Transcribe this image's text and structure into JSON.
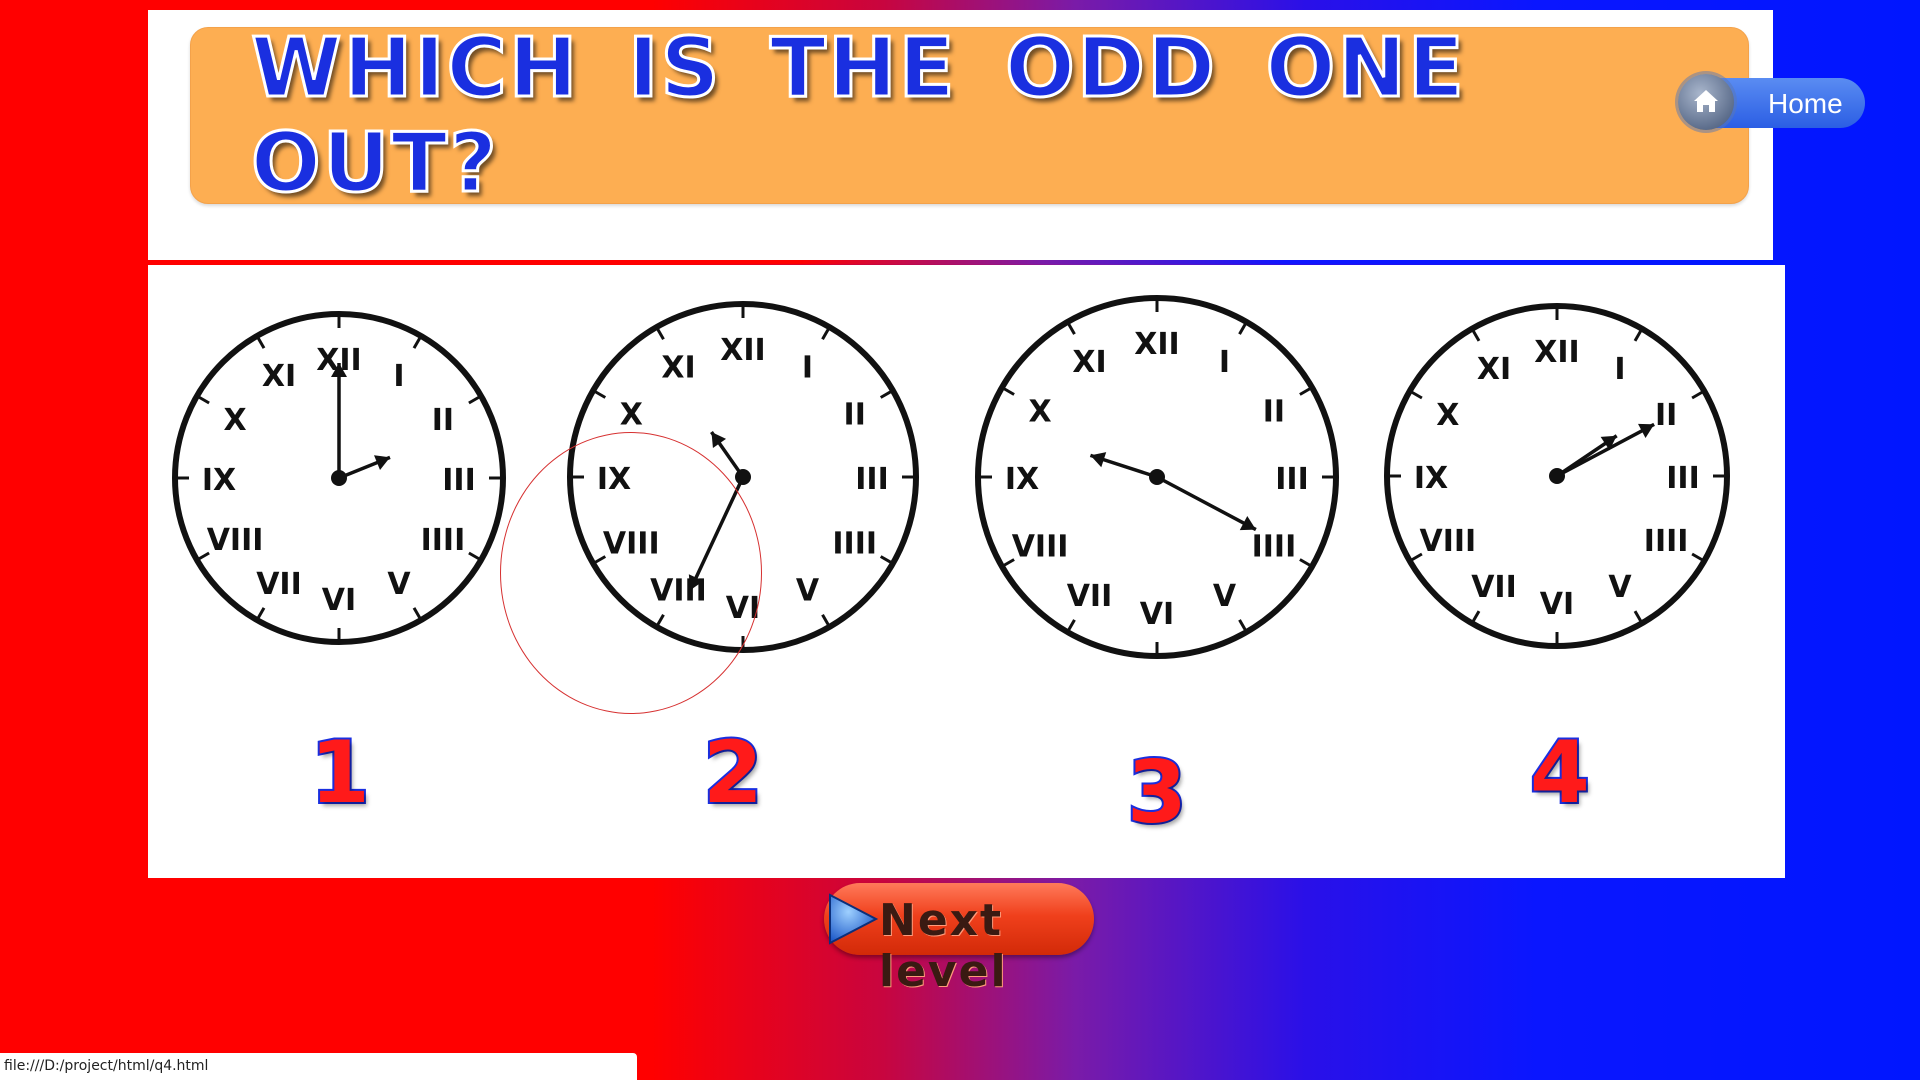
{
  "title": "WHICH IS THE ODD ONE OUT?",
  "home_button": {
    "label": "Home",
    "icon": "home-icon"
  },
  "clock_numerals": [
    "XII",
    "I",
    "II",
    "III",
    "IIII",
    "V",
    "VI",
    "VII",
    "VIII",
    "IX",
    "X",
    "XI"
  ],
  "options": [
    {
      "label": "1",
      "clock_face_numerals": [
        "XII",
        "I",
        "II",
        "III",
        "IIII",
        "V",
        "VI",
        "VII",
        "VIII",
        "IX",
        "X",
        "XI"
      ]
    },
    {
      "label": "2",
      "clock_face_numerals": [
        "XII",
        "I",
        "II",
        "III",
        "IIII",
        "V",
        "VI",
        "VIII",
        "VIII",
        "IX",
        "X",
        "XI"
      ]
    },
    {
      "label": "3",
      "clock_face_numerals": [
        "XII",
        "I",
        "II",
        "III",
        "IIII",
        "V",
        "VI",
        "VII",
        "VIII",
        "IX",
        "X",
        "XI"
      ]
    },
    {
      "label": "4",
      "clock_face_numerals": [
        "XII",
        "I",
        "II",
        "III",
        "IIII",
        "V",
        "VI",
        "VII",
        "VIII",
        "IX",
        "X",
        "XI"
      ]
    }
  ],
  "next_button": {
    "label": "Next level",
    "icon": "play-arrow-icon"
  },
  "status_bar": {
    "url": "file:///D:/project/html/q4.html"
  },
  "colors": {
    "title_text": "#1a2fe0",
    "banner": "#fdae52",
    "number_fill": "#ff1a1a",
    "number_stroke": "#1a2fe0"
  }
}
